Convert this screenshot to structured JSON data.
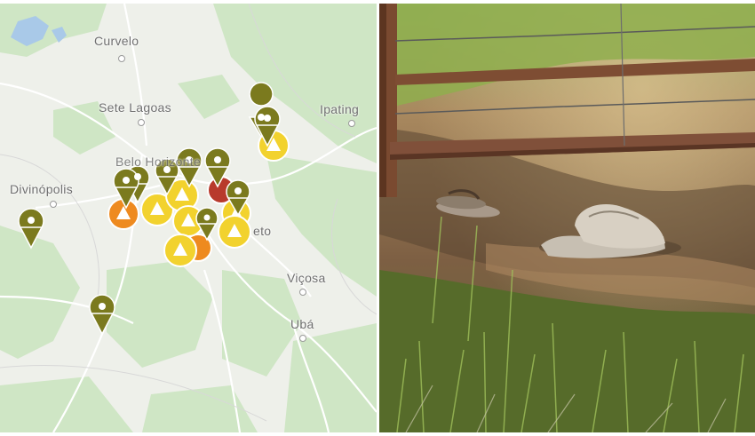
{
  "map": {
    "cities": [
      {
        "id": "curvelo",
        "name": "Curvelo"
      },
      {
        "id": "sete-lagoas",
        "name": "Sete Lagoas"
      },
      {
        "id": "ipating",
        "name": "Ipating"
      },
      {
        "id": "divinopolis",
        "name": "Divinópolis"
      },
      {
        "id": "belo-horizonte",
        "name": "Belo Horizonte"
      },
      {
        "id": "vicosa",
        "name": "Viçosa"
      },
      {
        "id": "uba",
        "name": "Ubá"
      },
      {
        "id": "ouro-preto",
        "name": "eto"
      }
    ],
    "colors": {
      "land": "#eef0ea",
      "forest": "#c9e3c0",
      "roads": "#ffffff",
      "water": "#a9c9e8",
      "pin_olive": "#7b7a1e",
      "warning_yellow": "#f2d22e",
      "warning_orange": "#ee8a1f",
      "alert_red": "#b83a2c"
    },
    "marker_types": [
      "olive-location-pin",
      "yellow-warning-triangle",
      "orange-warning-triangle",
      "red-alert-marker"
    ]
  },
  "photo": {
    "subject": "",
    "colors": {
      "dirt": "#8a6b4c",
      "grass": "#6f8d3a",
      "fence": "#7a4a30",
      "hat": "#cfc6b8",
      "sandals": "#9b8c7c"
    }
  }
}
